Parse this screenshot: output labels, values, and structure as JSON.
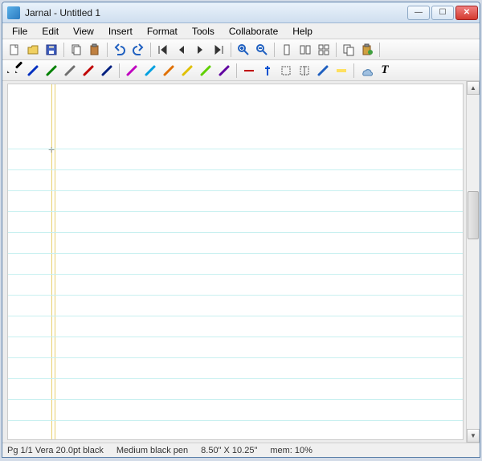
{
  "window": {
    "title": "Jarnal - Untitled 1"
  },
  "menu": {
    "file": "File",
    "edit": "Edit",
    "view": "View",
    "insert": "Insert",
    "format": "Format",
    "tools": "Tools",
    "collaborate": "Collaborate",
    "help": "Help"
  },
  "toolbar1": {
    "new": "new",
    "open": "open",
    "save": "save",
    "copy": "copy",
    "paste": "paste",
    "undo": "undo",
    "redo": "redo",
    "first": "first",
    "prev": "prev",
    "next": "next",
    "last": "last",
    "zoom_in": "zoom-in",
    "zoom_out": "zoom-out",
    "page1": "page-single",
    "page2": "page-double",
    "page3": "page-grid",
    "dup": "duplicate",
    "clip": "clipboard"
  },
  "toolbar2": {
    "pens": [
      "black",
      "blue",
      "green",
      "gray",
      "red",
      "darkblue",
      "magenta",
      "cyan",
      "orange",
      "yellow",
      "lime",
      "purple"
    ],
    "line": "line",
    "cursor": "cursor",
    "sel_rect": "select-rect",
    "sel_lasso": "select-lasso",
    "eraser": "eraser",
    "highlighter": "highlighter",
    "cloud": "cloud",
    "text": "T"
  },
  "status": {
    "page": "Pg 1/1 Vera 20.0pt black",
    "pen": "Medium black pen",
    "size": "8.50\" X 10.25\"",
    "mem": "mem: 10%"
  }
}
